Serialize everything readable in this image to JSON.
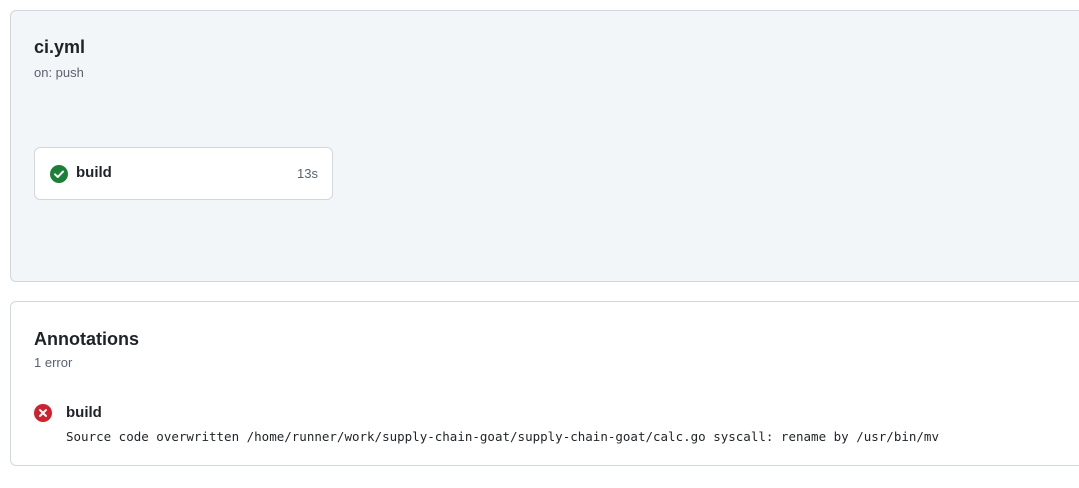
{
  "workflow": {
    "title": "ci.yml",
    "trigger": "on: push",
    "jobs": [
      {
        "name": "build",
        "status": "success",
        "status_icon": "check-circle-fill-icon",
        "duration": "13s"
      }
    ]
  },
  "annotations": {
    "title": "Annotations",
    "count": "1 error",
    "items": [
      {
        "severity": "error",
        "icon": "x-circle-fill-icon",
        "job": "build",
        "message": "Source code overwritten /home/runner/work/supply-chain-goat/supply-chain-goat/calc.go syscall: rename by /usr/bin/mv"
      }
    ]
  },
  "colors": {
    "success": "#1a7f37",
    "error": "#cf222e",
    "panel_bg": "#f3f6f9",
    "border": "#d0d7de",
    "muted_text": "#59636e"
  }
}
